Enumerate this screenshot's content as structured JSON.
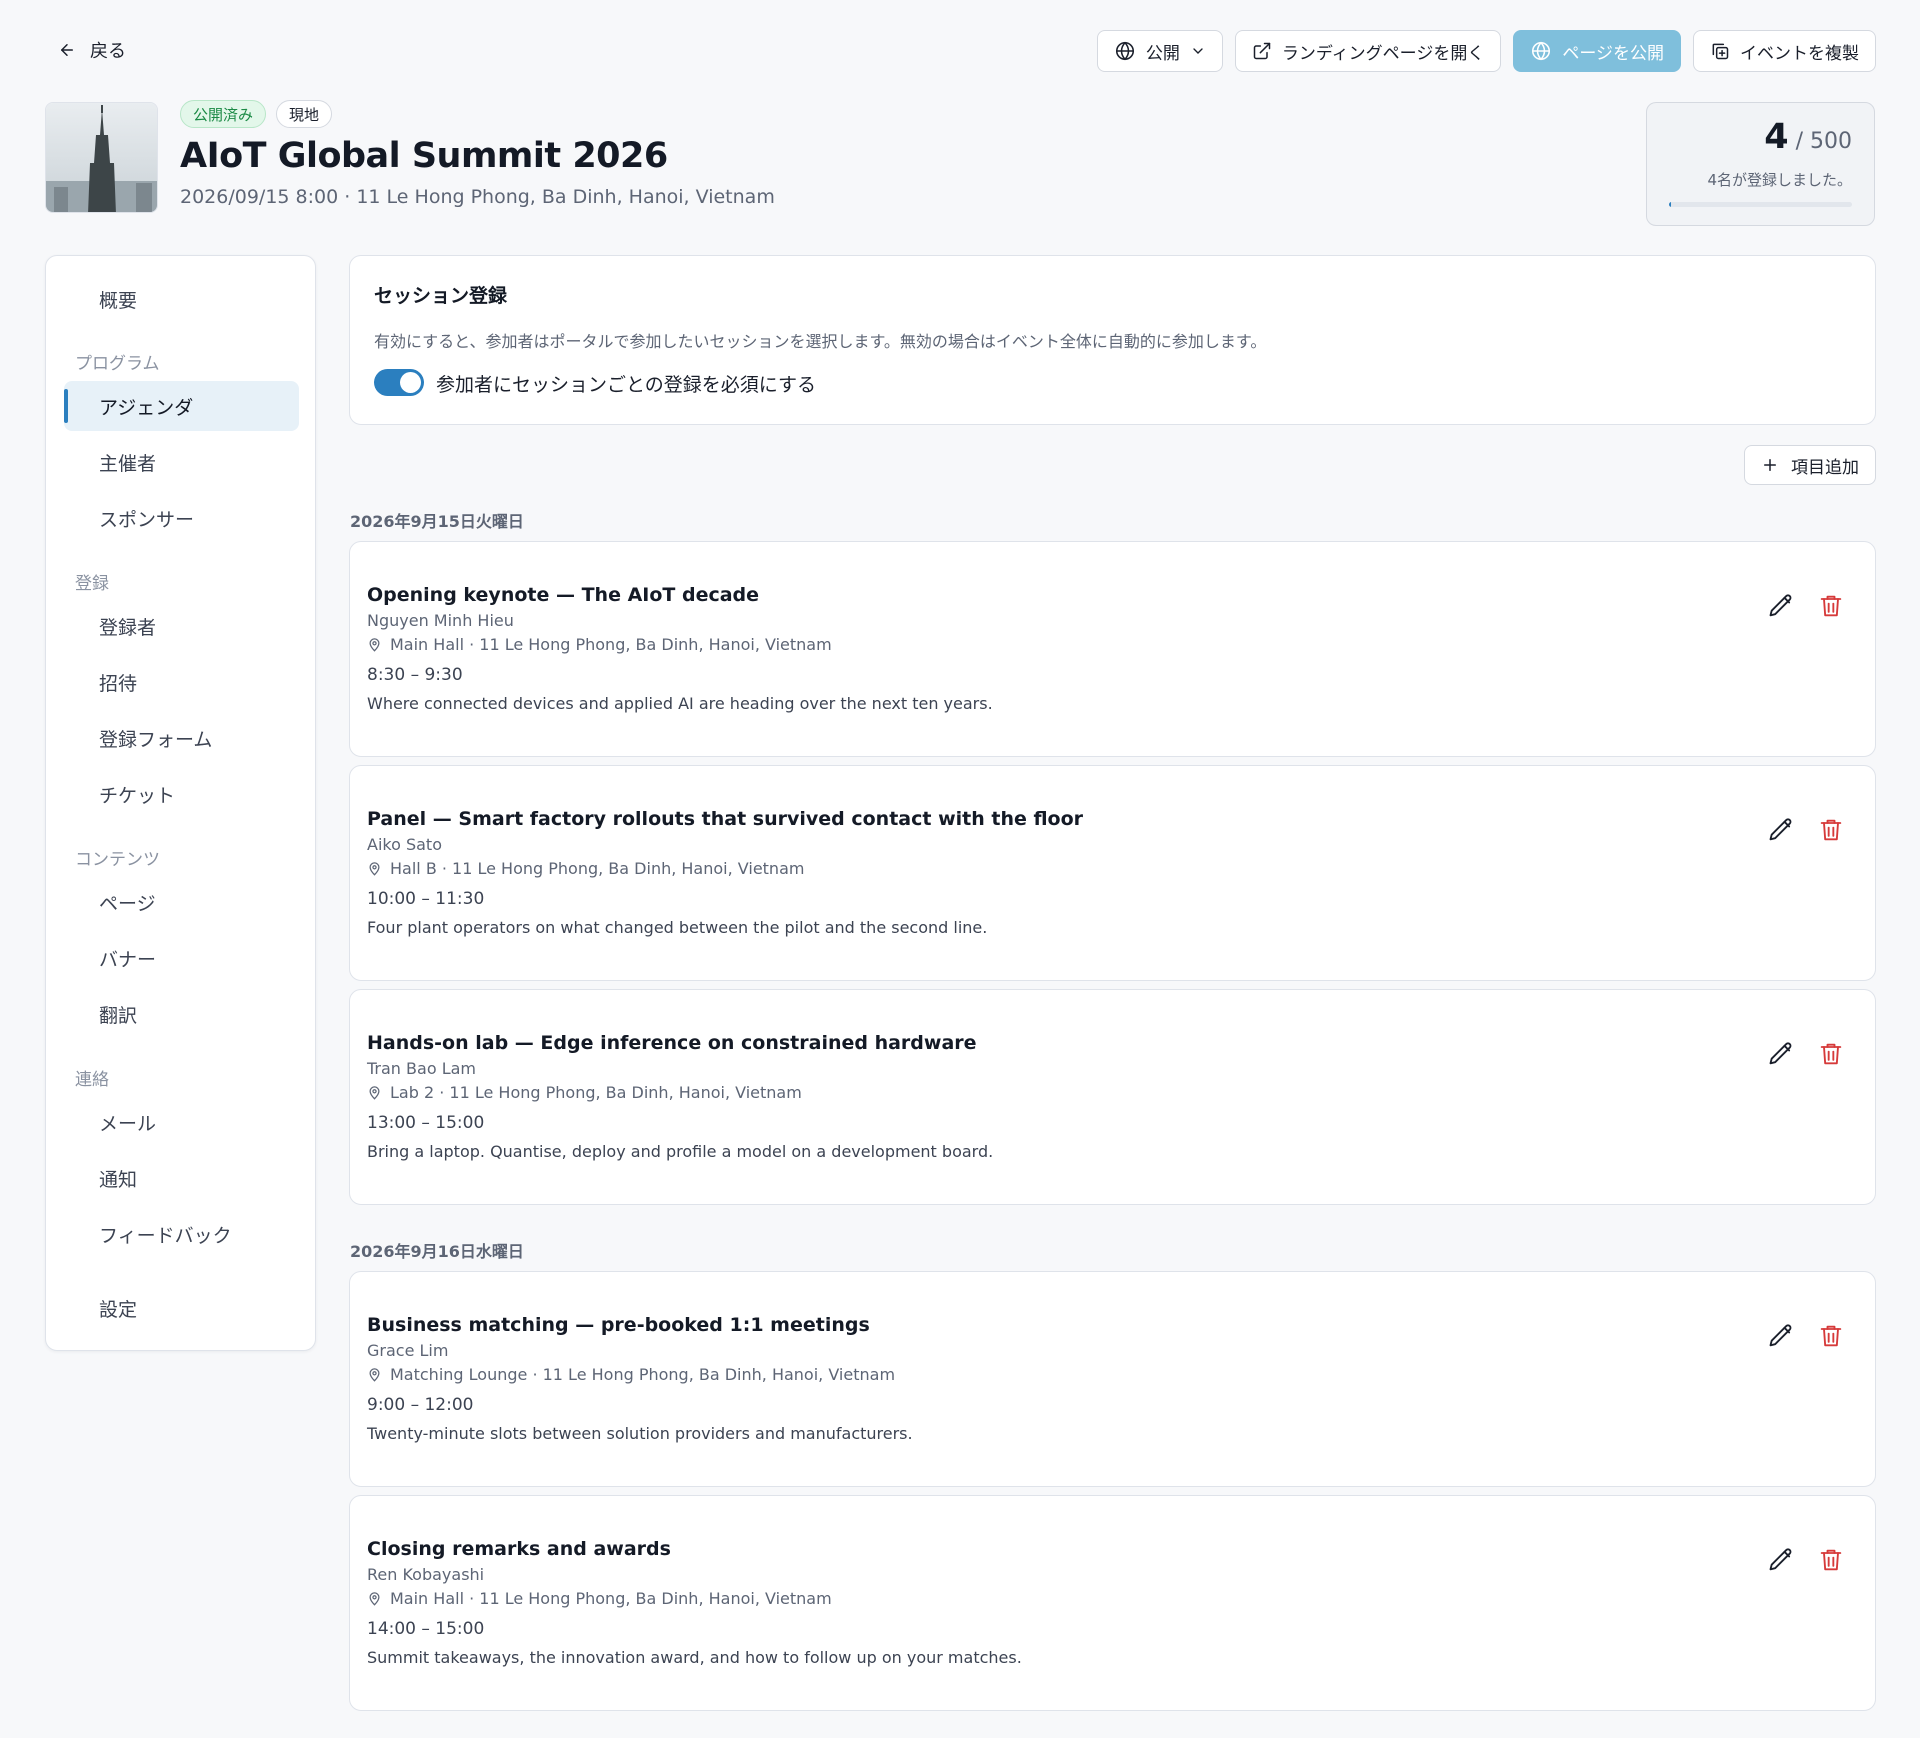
{
  "topbar": {
    "back_label": "戻る",
    "visibility_label": "公開",
    "open_landing_label": "ランディングページを開く",
    "publish_label": "ページを公開",
    "duplicate_label": "イベントを複製"
  },
  "event": {
    "status_badge": "公開済み",
    "type_badge": "現地",
    "title": "AIoT Global Summit 2026",
    "subtitle": "2026/09/15 8:00 · 11 Le Hong Phong, Ba Dinh, Hanoi, Vietnam",
    "registered": "4",
    "capacity": "/ 500",
    "registered_note": "4名が登録しました。",
    "registered_fraction": 0.008
  },
  "sidebar": {
    "overview": "概要",
    "group_program": "プログラム",
    "agenda": "アジェンダ",
    "organizers": "主催者",
    "sponsors": "スポンサー",
    "group_registration": "登録",
    "registrants": "登録者",
    "invitations": "招待",
    "registration_form": "登録フォーム",
    "tickets": "チケット",
    "group_content": "コンテンツ",
    "pages": "ページ",
    "banners": "バナー",
    "translations": "翻訳",
    "group_contact": "連絡",
    "mail": "メール",
    "notifications": "通知",
    "feedback": "フィードバック",
    "settings": "設定"
  },
  "session_registration": {
    "title": "セッション登録",
    "description": "有効にすると、参加者はポータルで参加したいセッションを選択します。無効の場合はイベント全体に自動的に参加します。",
    "toggle_label": "参加者にセッションごとの登録を必須にする",
    "toggle_on": true
  },
  "add_item_label": "項目追加",
  "days": [
    {
      "label": "2026年9月15日火曜日",
      "items": [
        {
          "title": "Opening keynote — The AIoT decade",
          "speaker": "Nguyen Minh Hieu",
          "location": "Main Hall · 11 Le Hong Phong, Ba Dinh, Hanoi, Vietnam",
          "time": "8:30 – 9:30",
          "description": "Where connected devices and applied AI are heading over the next ten years."
        },
        {
          "title": "Panel — Smart factory rollouts that survived contact with the floor",
          "speaker": "Aiko Sato",
          "location": "Hall B · 11 Le Hong Phong, Ba Dinh, Hanoi, Vietnam",
          "time": "10:00 – 11:30",
          "description": "Four plant operators on what changed between the pilot and the second line."
        },
        {
          "title": "Hands-on lab — Edge inference on constrained hardware",
          "speaker": "Tran Bao Lam",
          "location": "Lab 2 · 11 Le Hong Phong, Ba Dinh, Hanoi, Vietnam",
          "time": "13:00 – 15:00",
          "description": "Bring a laptop. Quantise, deploy and profile a model on a development board."
        }
      ]
    },
    {
      "label": "2026年9月16日水曜日",
      "items": [
        {
          "title": "Business matching — pre-booked 1:1 meetings",
          "speaker": "Grace Lim",
          "location": "Matching Lounge · 11 Le Hong Phong, Ba Dinh, Hanoi, Vietnam",
          "time": "9:00 – 12:00",
          "description": "Twenty-minute slots between solution providers and manufacturers."
        },
        {
          "title": "Closing remarks and awards",
          "speaker": "Ren Kobayashi",
          "location": "Main Hall · 11 Le Hong Phong, Ba Dinh, Hanoi, Vietnam",
          "time": "14:00 – 15:00",
          "description": "Summit takeaways, the innovation award, and how to follow up on your matches."
        }
      ]
    }
  ],
  "colors": {
    "accent": "#2b7fbf",
    "publish_button": "#7fbfdc",
    "published_badge": "#1b8a45",
    "delete_icon": "#d63a3a"
  }
}
